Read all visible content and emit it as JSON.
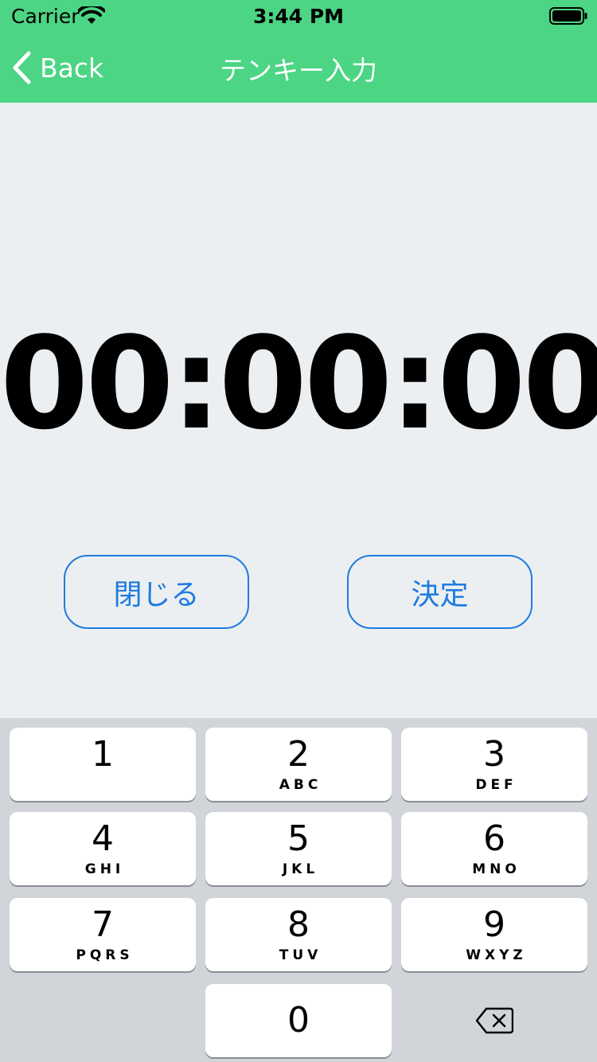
{
  "status_bar": {
    "carrier": "Carrier",
    "time": "3:44 PM"
  },
  "nav": {
    "back_label": "Back",
    "title": "テンキー入力"
  },
  "timer": {
    "display": "00:00:00"
  },
  "buttons": {
    "close_label": "閉じる",
    "confirm_label": "決定"
  },
  "keypad": {
    "keys": [
      {
        "digit": "1",
        "letters": ""
      },
      {
        "digit": "2",
        "letters": "ABC"
      },
      {
        "digit": "3",
        "letters": "DEF"
      },
      {
        "digit": "4",
        "letters": "GHI"
      },
      {
        "digit": "5",
        "letters": "JKL"
      },
      {
        "digit": "6",
        "letters": "MNO"
      },
      {
        "digit": "7",
        "letters": "PQRS"
      },
      {
        "digit": "8",
        "letters": "TUV"
      },
      {
        "digit": "9",
        "letters": "WXYZ"
      },
      {
        "digit": "0",
        "letters": ""
      }
    ]
  },
  "colors": {
    "nav_background": "#4CD584",
    "page_background": "#ECEFF1",
    "accent_blue": "#1E7BE0",
    "keypad_background": "#D1D4D9"
  },
  "icons": [
    "wifi-icon",
    "battery-icon",
    "back-chevron-icon",
    "delete-icon"
  ]
}
